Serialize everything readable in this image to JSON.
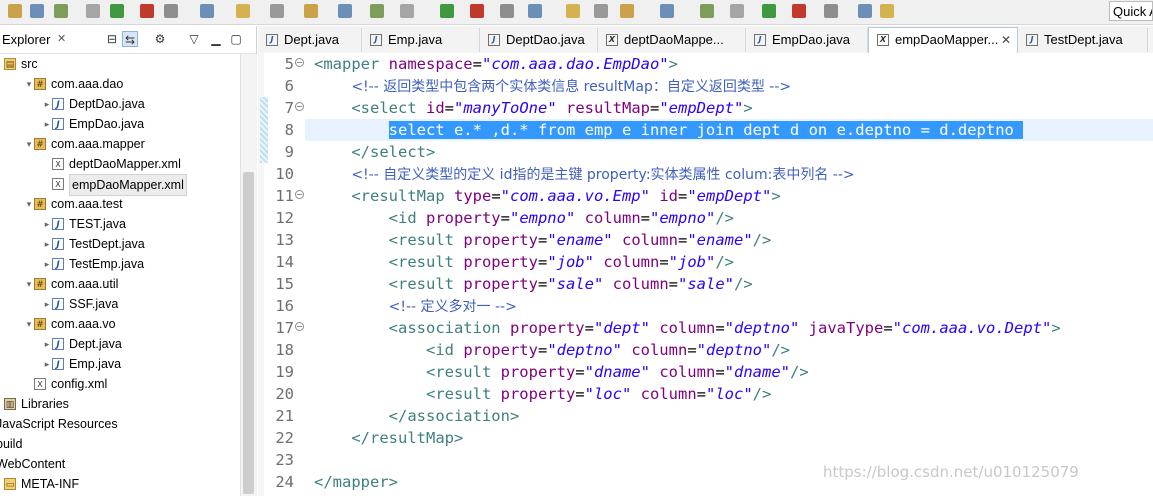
{
  "toolbar": {
    "quick_access_placeholder": "Quick A",
    "icons": [
      "new-icon",
      "save-icon",
      "print-icon",
      "debug-icon",
      "run-icon",
      "external-tools-icon",
      "search-icon",
      "open-type-icon",
      "back-icon",
      "forward-icon"
    ]
  },
  "explorer": {
    "title": "Explorer",
    "close": "✕",
    "tree": [
      {
        "label": "src",
        "icon": "source-folder-icon",
        "indent": 0,
        "arrow": "",
        "glyph": "▤"
      },
      {
        "label": "com.aaa.dao",
        "icon": "package-icon",
        "indent": 1,
        "arrow": "▾",
        "glyph": "#"
      },
      {
        "label": "DeptDao.java",
        "icon": "java-file-icon",
        "indent": 2,
        "arrow": "▸",
        "glyph": "J"
      },
      {
        "label": "EmpDao.java",
        "icon": "java-file-icon",
        "indent": 2,
        "arrow": "▸",
        "glyph": "J"
      },
      {
        "label": "com.aaa.mapper",
        "icon": "package-icon",
        "indent": 1,
        "arrow": "▾",
        "glyph": "#"
      },
      {
        "label": "deptDaoMapper.xml",
        "icon": "xml-file-icon",
        "indent": 2,
        "arrow": "",
        "glyph": "X"
      },
      {
        "label": "empDaoMapper.xml",
        "icon": "xml-file-icon",
        "indent": 2,
        "arrow": "",
        "glyph": "X",
        "selected": true
      },
      {
        "label": "com.aaa.test",
        "icon": "package-icon",
        "indent": 1,
        "arrow": "▾",
        "glyph": "#"
      },
      {
        "label": "TEST.java",
        "icon": "java-file-icon",
        "indent": 2,
        "arrow": "▸",
        "glyph": "J"
      },
      {
        "label": "TestDept.java",
        "icon": "java-file-icon",
        "indent": 2,
        "arrow": "▸",
        "glyph": "J"
      },
      {
        "label": "TestEmp.java",
        "icon": "java-file-icon",
        "indent": 2,
        "arrow": "▸",
        "glyph": "J"
      },
      {
        "label": "com.aaa.util",
        "icon": "package-icon",
        "indent": 1,
        "arrow": "▾",
        "glyph": "#"
      },
      {
        "label": "SSF.java",
        "icon": "java-file-icon",
        "indent": 2,
        "arrow": "▸",
        "glyph": "J"
      },
      {
        "label": "com.aaa.vo",
        "icon": "package-icon",
        "indent": 1,
        "arrow": "▾",
        "glyph": "#"
      },
      {
        "label": "Dept.java",
        "icon": "java-file-icon",
        "indent": 2,
        "arrow": "▸",
        "glyph": "J"
      },
      {
        "label": "Emp.java",
        "icon": "java-file-icon",
        "indent": 2,
        "arrow": "▸",
        "glyph": "J"
      },
      {
        "label": "config.xml",
        "icon": "xml-file-icon",
        "indent": 1,
        "arrow": "",
        "glyph": "X"
      },
      {
        "label": "Libraries",
        "icon": "library-icon",
        "indent": 0,
        "arrow": "▸",
        "glyph": "▥"
      },
      {
        "label": "JavaScript Resources",
        "icon": "js-resources-icon",
        "indent": -1,
        "arrow": "",
        "glyph": ""
      },
      {
        "label": "build",
        "icon": "folder-icon",
        "indent": -1,
        "arrow": "",
        "glyph": ""
      },
      {
        "label": "WebContent",
        "icon": "folder-icon",
        "indent": -1,
        "arrow": "",
        "glyph": ""
      },
      {
        "label": "META-INF",
        "icon": "folder-icon",
        "indent": 0,
        "arrow": "",
        "glyph": "▭"
      }
    ]
  },
  "tabs": [
    {
      "label": "Dept.java",
      "type": "java"
    },
    {
      "label": "Emp.java",
      "type": "java"
    },
    {
      "label": "DeptDao.java",
      "type": "java"
    },
    {
      "label": "deptDaoMappe...",
      "type": "xml"
    },
    {
      "label": "EmpDao.java",
      "type": "java"
    },
    {
      "label": "empDaoMapper...",
      "type": "xml",
      "active": true,
      "close": "✕"
    },
    {
      "label": "TestDept.java",
      "type": "java"
    }
  ],
  "editor": {
    "lines": [
      {
        "n": "5",
        "fold": "⊖",
        "tokens": [
          [
            "tag",
            "<mapper "
          ],
          [
            "attr",
            "namespace"
          ],
          [
            "txt",
            "="
          ],
          [
            "val",
            "\"com.aaa.dao.EmpDao\""
          ],
          [
            "tag",
            ">"
          ]
        ]
      },
      {
        "n": "6",
        "tokens": [
          [
            "txt",
            "    "
          ],
          [
            "cmt",
            "<!-- 返回类型中包含两个实体类信息 resultMap：自定义返回类型 -->"
          ]
        ]
      },
      {
        "n": "7",
        "fold": "⊖",
        "tokens": [
          [
            "txt",
            "    "
          ],
          [
            "tag",
            "<select "
          ],
          [
            "attr",
            "id"
          ],
          [
            "txt",
            "="
          ],
          [
            "val",
            "\"manyToOne\""
          ],
          [
            "txt",
            " "
          ],
          [
            "attr",
            "resultMap"
          ],
          [
            "txt",
            "="
          ],
          [
            "val",
            "\"empDept\""
          ],
          [
            "tag",
            ">"
          ]
        ]
      },
      {
        "n": "8",
        "selected": true,
        "tokens": [
          [
            "txt",
            "        "
          ],
          [
            "sel",
            "select e.* ,d.* from emp e inner join dept d on e.deptno = d.deptno "
          ]
        ]
      },
      {
        "n": "9",
        "tokens": [
          [
            "txt",
            "    "
          ],
          [
            "tag",
            "</select>"
          ]
        ]
      },
      {
        "n": "10",
        "tokens": [
          [
            "txt",
            "    "
          ],
          [
            "cmt",
            "<!-- 自定义类型的定义 id指的是主键 property:实体类属性 colum:表中列名 -->"
          ]
        ]
      },
      {
        "n": "11",
        "fold": "⊖",
        "tokens": [
          [
            "txt",
            "    "
          ],
          [
            "tag",
            "<resultMap "
          ],
          [
            "attr",
            "type"
          ],
          [
            "txt",
            "="
          ],
          [
            "val",
            "\"com.aaa.vo.Emp\""
          ],
          [
            "txt",
            " "
          ],
          [
            "attr",
            "id"
          ],
          [
            "txt",
            "="
          ],
          [
            "val",
            "\"empDept\""
          ],
          [
            "tag",
            ">"
          ]
        ]
      },
      {
        "n": "12",
        "tokens": [
          [
            "txt",
            "        "
          ],
          [
            "tag",
            "<id "
          ],
          [
            "attr",
            "property"
          ],
          [
            "txt",
            "="
          ],
          [
            "val",
            "\"empno\""
          ],
          [
            "txt",
            " "
          ],
          [
            "attr",
            "column"
          ],
          [
            "txt",
            "="
          ],
          [
            "val",
            "\"empno\""
          ],
          [
            "tag",
            "/>"
          ]
        ]
      },
      {
        "n": "13",
        "tokens": [
          [
            "txt",
            "        "
          ],
          [
            "tag",
            "<result "
          ],
          [
            "attr",
            "property"
          ],
          [
            "txt",
            "="
          ],
          [
            "val",
            "\"ename\""
          ],
          [
            "txt",
            " "
          ],
          [
            "attr",
            "column"
          ],
          [
            "txt",
            "="
          ],
          [
            "val",
            "\"ename\""
          ],
          [
            "tag",
            "/>"
          ]
        ]
      },
      {
        "n": "14",
        "tokens": [
          [
            "txt",
            "        "
          ],
          [
            "tag",
            "<result "
          ],
          [
            "attr",
            "property"
          ],
          [
            "txt",
            "="
          ],
          [
            "val",
            "\"job\""
          ],
          [
            "txt",
            " "
          ],
          [
            "attr",
            "column"
          ],
          [
            "txt",
            "="
          ],
          [
            "val",
            "\"job\""
          ],
          [
            "tag",
            "/>"
          ]
        ]
      },
      {
        "n": "15",
        "tokens": [
          [
            "txt",
            "        "
          ],
          [
            "tag",
            "<result "
          ],
          [
            "attr",
            "property"
          ],
          [
            "txt",
            "="
          ],
          [
            "val",
            "\"sale\""
          ],
          [
            "txt",
            " "
          ],
          [
            "attr",
            "column"
          ],
          [
            "txt",
            "="
          ],
          [
            "val",
            "\"sale\""
          ],
          [
            "tag",
            "/>"
          ]
        ]
      },
      {
        "n": "16",
        "tokens": [
          [
            "txt",
            "        "
          ],
          [
            "cmt",
            "<!-- 定义多对一 -->"
          ]
        ]
      },
      {
        "n": "17",
        "fold": "⊖",
        "tokens": [
          [
            "txt",
            "        "
          ],
          [
            "tag",
            "<association "
          ],
          [
            "attr",
            "property"
          ],
          [
            "txt",
            "="
          ],
          [
            "val",
            "\"dept\""
          ],
          [
            "txt",
            " "
          ],
          [
            "attr",
            "column"
          ],
          [
            "txt",
            "="
          ],
          [
            "val",
            "\"deptno\""
          ],
          [
            "txt",
            " "
          ],
          [
            "attr",
            "javaType"
          ],
          [
            "txt",
            "="
          ],
          [
            "val",
            "\"com.aaa.vo.Dept\""
          ],
          [
            "tag",
            ">"
          ]
        ]
      },
      {
        "n": "18",
        "tokens": [
          [
            "txt",
            "            "
          ],
          [
            "tag",
            "<id "
          ],
          [
            "attr",
            "property"
          ],
          [
            "txt",
            "="
          ],
          [
            "val",
            "\"deptno\""
          ],
          [
            "txt",
            " "
          ],
          [
            "attr",
            "column"
          ],
          [
            "txt",
            "="
          ],
          [
            "val",
            "\"deptno\""
          ],
          [
            "tag",
            "/>"
          ]
        ]
      },
      {
        "n": "19",
        "tokens": [
          [
            "txt",
            "            "
          ],
          [
            "tag",
            "<result "
          ],
          [
            "attr",
            "property"
          ],
          [
            "txt",
            "="
          ],
          [
            "val",
            "\"dname\""
          ],
          [
            "txt",
            " "
          ],
          [
            "attr",
            "column"
          ],
          [
            "txt",
            "="
          ],
          [
            "val",
            "\"dname\""
          ],
          [
            "tag",
            "/>"
          ]
        ]
      },
      {
        "n": "20",
        "tokens": [
          [
            "txt",
            "            "
          ],
          [
            "tag",
            "<result "
          ],
          [
            "attr",
            "property"
          ],
          [
            "txt",
            "="
          ],
          [
            "val",
            "\"loc\""
          ],
          [
            "txt",
            " "
          ],
          [
            "attr",
            "column"
          ],
          [
            "txt",
            "="
          ],
          [
            "val",
            "\"loc\""
          ],
          [
            "tag",
            "/>"
          ]
        ]
      },
      {
        "n": "21",
        "tokens": [
          [
            "txt",
            "        "
          ],
          [
            "tag",
            "</association>"
          ]
        ]
      },
      {
        "n": "22",
        "tokens": [
          [
            "txt",
            "    "
          ],
          [
            "tag",
            "</resultMap>"
          ]
        ]
      },
      {
        "n": "23",
        "tokens": []
      },
      {
        "n": "24",
        "tokens": [
          [
            "tag",
            "</mapper>"
          ]
        ]
      }
    ]
  },
  "watermark": "https://blog.csdn.net/u010125079",
  "colors": {
    "selection": "#3399ff",
    "tag": "#3f7f7f",
    "attr": "#7f007f",
    "value": "#2a00ff",
    "comment": "#3f5fbf"
  }
}
